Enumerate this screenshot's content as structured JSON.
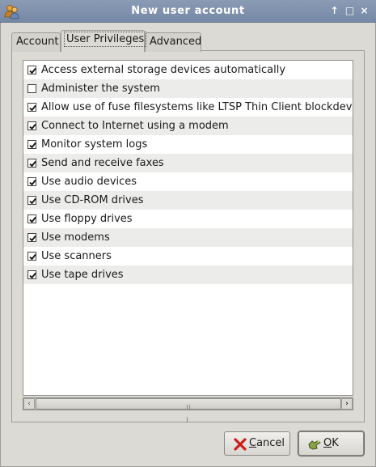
{
  "window": {
    "title": "New user account",
    "controls": [
      "↑",
      "□",
      "×"
    ]
  },
  "tabs": [
    {
      "label": "Account",
      "active": false
    },
    {
      "label": "User Privileges",
      "active": true
    },
    {
      "label": "Advanced",
      "active": false
    }
  ],
  "privileges": [
    {
      "label": "Access external storage devices automatically",
      "checked": true
    },
    {
      "label": "Administer the system",
      "checked": false
    },
    {
      "label": "Allow use of fuse filesystems like LTSP Thin Client blockdevices",
      "checked": true
    },
    {
      "label": "Connect to Internet using a modem",
      "checked": true
    },
    {
      "label": "Monitor system logs",
      "checked": true
    },
    {
      "label": "Send and receive faxes",
      "checked": true
    },
    {
      "label": "Use audio devices",
      "checked": true
    },
    {
      "label": "Use CD-ROM drives",
      "checked": true
    },
    {
      "label": "Use floppy drives",
      "checked": true
    },
    {
      "label": "Use modems",
      "checked": true
    },
    {
      "label": "Use scanners",
      "checked": true
    },
    {
      "label": "Use tape drives",
      "checked": true
    }
  ],
  "buttons": {
    "cancel": {
      "mnemonic": "C",
      "rest": "ancel",
      "icon": "cancel-x-icon"
    },
    "ok": {
      "mnemonic": "O",
      "rest": "K",
      "icon": "ok-hand-icon"
    }
  },
  "colors": {
    "titlebar": "#7f91ad",
    "window_bg": "#dcdad5",
    "list_alt_row": "#ececea",
    "cancel_icon": "#cc1f1a",
    "ok_icon": "#6f8a3a"
  }
}
